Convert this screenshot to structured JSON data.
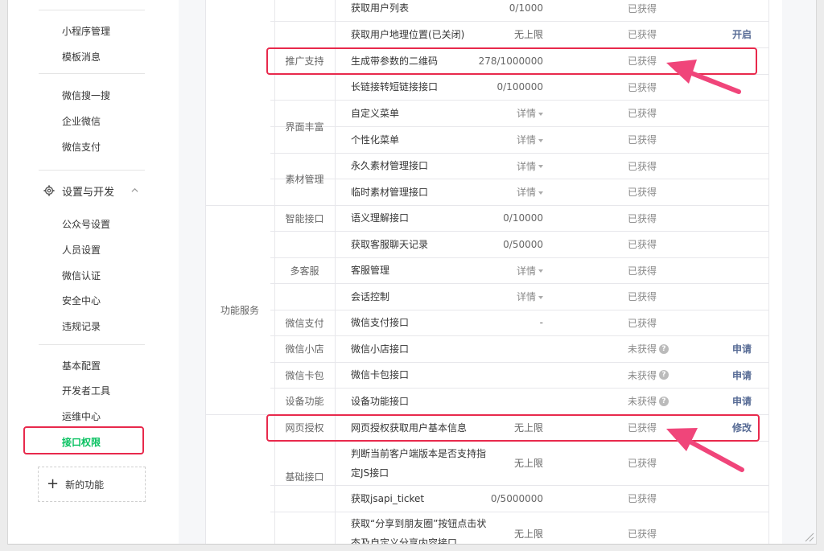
{
  "sidebar": {
    "items_top": [
      "小程序管理",
      "模板消息"
    ],
    "items_wechat": [
      "微信搜一搜",
      "企业微信",
      "微信支付"
    ],
    "section_title": "设置与开发",
    "items_settings": [
      "公众号设置",
      "人员设置",
      "微信认证",
      "安全中心",
      "违规记录"
    ],
    "items_dev": [
      "基本配置",
      "开发者工具",
      "运维中心",
      "接口权限"
    ],
    "new_function": "新的功能"
  },
  "table": {
    "categories": [
      "功能服务"
    ],
    "subcategories": [
      "推广支持",
      "界面丰富",
      "素材管理",
      "智能接口",
      "多客服",
      "微信支付",
      "微信小店",
      "微信卡包",
      "设备功能",
      "网页授权",
      "基础接口"
    ],
    "detail_label": "详情",
    "rows": [
      {
        "iface": "获取用户列表",
        "limit": "0/1000",
        "status": "已获得",
        "op": ""
      },
      {
        "iface": "获取用户地理位置(已关闭)",
        "limit": "无上限",
        "status": "已获得",
        "op": "开启"
      },
      {
        "iface": "生成带参数的二维码",
        "limit": "278/1000000",
        "status": "已获得",
        "op": ""
      },
      {
        "iface": "长链接转短链接接口",
        "limit": "0/100000",
        "status": "已获得",
        "op": ""
      },
      {
        "iface": "自定义菜单",
        "limit": "",
        "status": "已获得",
        "op": ""
      },
      {
        "iface": "个性化菜单",
        "limit": "",
        "status": "已获得",
        "op": ""
      },
      {
        "iface": "永久素材管理接口",
        "limit": "",
        "status": "已获得",
        "op": ""
      },
      {
        "iface": "临时素材管理接口",
        "limit": "",
        "status": "已获得",
        "op": ""
      },
      {
        "iface": "语义理解接口",
        "limit": "0/10000",
        "status": "已获得",
        "op": ""
      },
      {
        "iface": "获取客服聊天记录",
        "limit": "0/50000",
        "status": "已获得",
        "op": ""
      },
      {
        "iface": "客服管理",
        "limit": "",
        "status": "已获得",
        "op": ""
      },
      {
        "iface": "会话控制",
        "limit": "",
        "status": "已获得",
        "op": ""
      },
      {
        "iface": "微信支付接口",
        "limit": "-",
        "status": "已获得",
        "op": ""
      },
      {
        "iface": "微信小店接口",
        "limit": "",
        "status": "未获得",
        "op": "申请"
      },
      {
        "iface": "微信卡包接口",
        "limit": "",
        "status": "未获得",
        "op": "申请"
      },
      {
        "iface": "设备功能接口",
        "limit": "",
        "status": "未获得",
        "op": "申请"
      },
      {
        "iface": "网页授权获取用户基本信息",
        "limit": "无上限",
        "status": "已获得",
        "op": "修改"
      },
      {
        "iface": "判断当前客户端版本是否支持指",
        "iface2": "定JS接口",
        "limit": "无上限",
        "status": "已获得",
        "op": ""
      },
      {
        "iface": "获取jsapi_ticket",
        "limit": "0/5000000",
        "status": "已获得",
        "op": ""
      },
      {
        "iface": "获取“分享到朋友圈”按钮点击状",
        "iface2": "态及自定义分享内容接口",
        "limit": "无上限",
        "status": "已获得",
        "op": ""
      }
    ]
  },
  "colors": {
    "accent_green": "#07c160",
    "link_blue": "#576b95",
    "highlight_red": "#e8294c",
    "arrow_pink": "#f0457a"
  },
  "icons": [
    "gear-icon",
    "chevron-up-icon",
    "plus-icon",
    "question-icon",
    "dropdown-triangle-icon",
    "resize-grip-icon"
  ]
}
